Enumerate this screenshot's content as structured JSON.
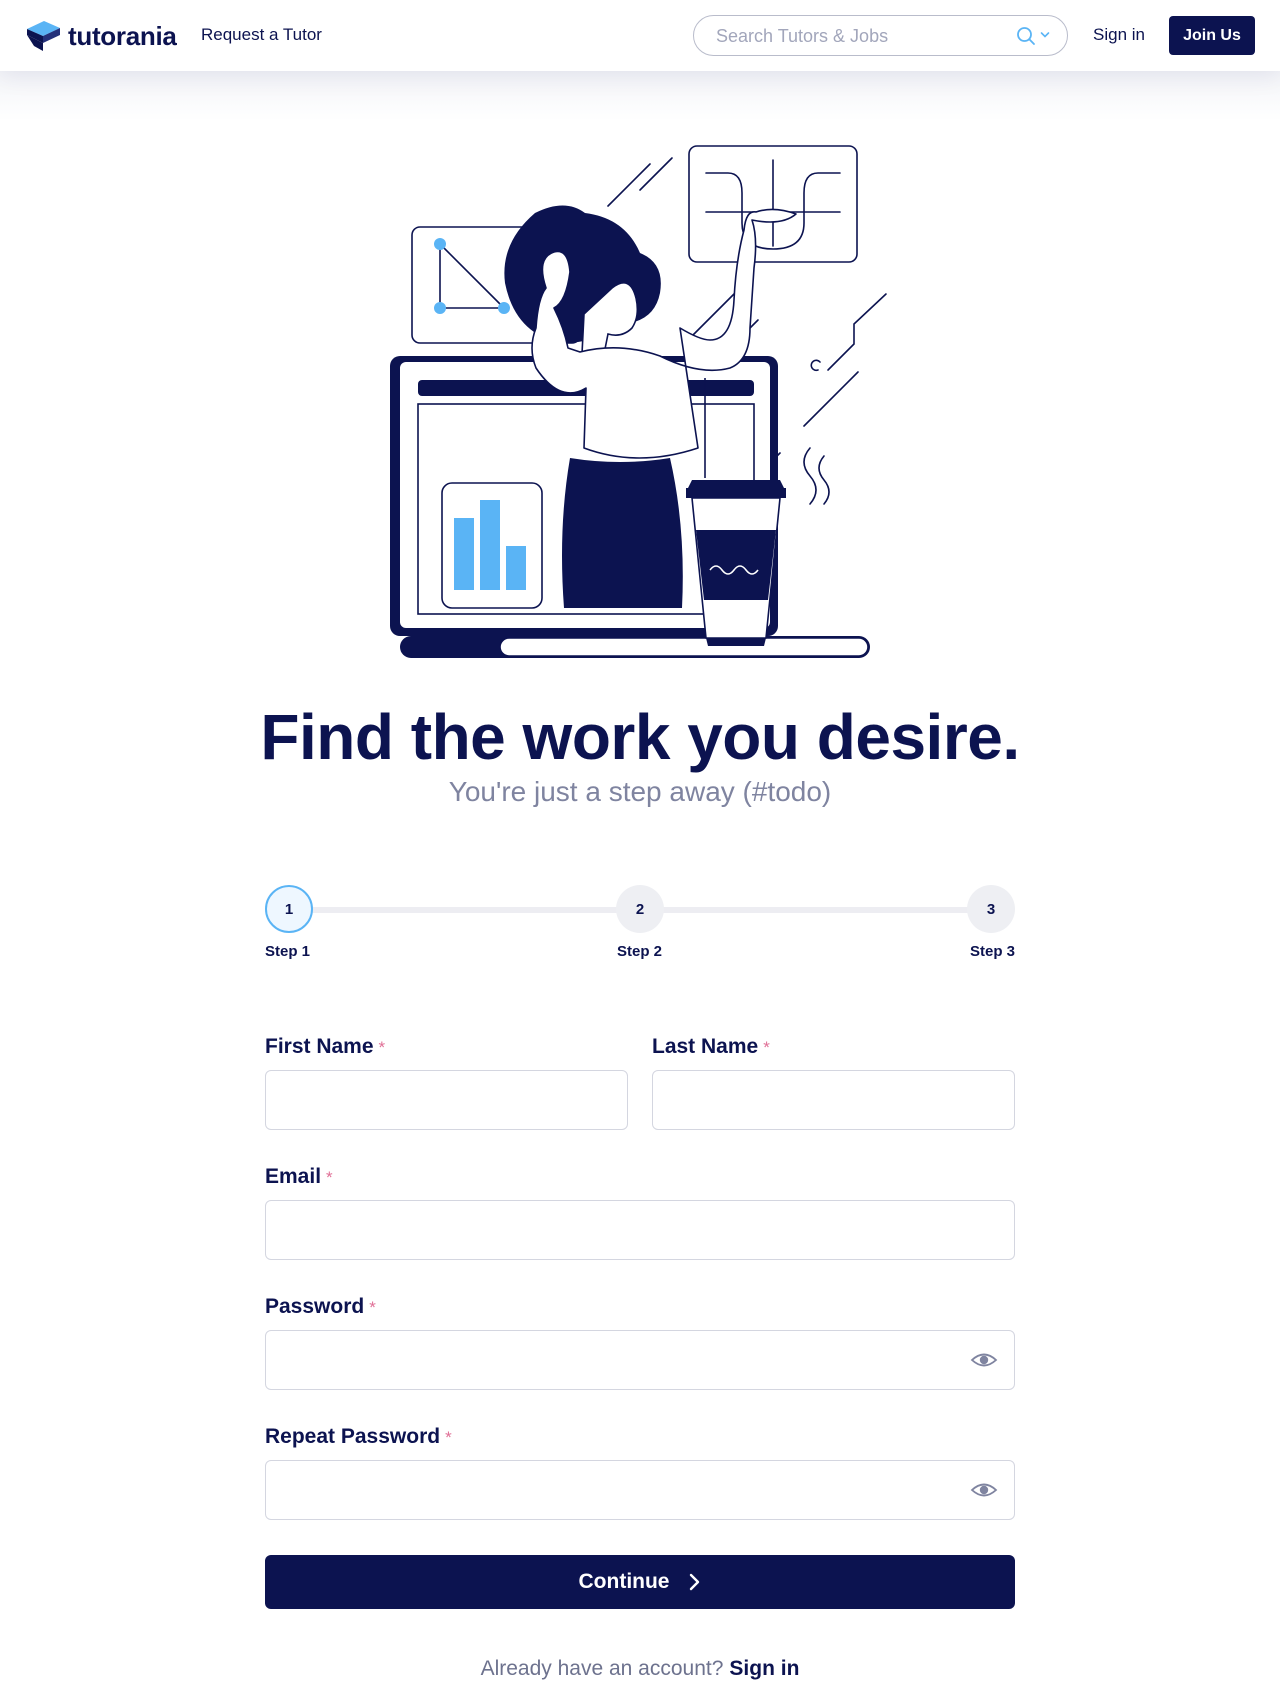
{
  "header": {
    "brand": "tutorania",
    "nav_request": "Request a Tutor",
    "search": {
      "placeholder": "Search Tutors & Jobs",
      "value": ""
    },
    "sign_in": "Sign in",
    "join": "Join Us"
  },
  "hero": {
    "title": "Find the work you desire.",
    "subtitle": "You're just a step away (#todo)"
  },
  "stepper": {
    "active_step": 1,
    "steps": [
      {
        "number": "1",
        "label": "Step 1"
      },
      {
        "number": "2",
        "label": "Step 2"
      },
      {
        "number": "3",
        "label": "Step 3"
      }
    ]
  },
  "form": {
    "required_mark": "*",
    "first_name": {
      "label": "First Name",
      "value": ""
    },
    "last_name": {
      "label": "Last Name",
      "value": ""
    },
    "email": {
      "label": "Email",
      "value": ""
    },
    "password": {
      "label": "Password",
      "value": ""
    },
    "repeat_password": {
      "label": "Repeat Password",
      "value": ""
    },
    "continue": "Continue"
  },
  "footer": {
    "prompt": "Already have an account?",
    "sign_in": "Sign in"
  },
  "icons": {
    "logo": "tutorania-logo-icon",
    "search": "search-icon",
    "dropdown": "chevron-down-icon",
    "password_toggle": "eye-icon",
    "continue_arrow": "chevron-right-icon"
  },
  "colors": {
    "brand_navy": "#0c1350",
    "accent_blue": "#5ab4f5",
    "required_pink": "#e06f96",
    "muted_text": "#7f84a0"
  }
}
